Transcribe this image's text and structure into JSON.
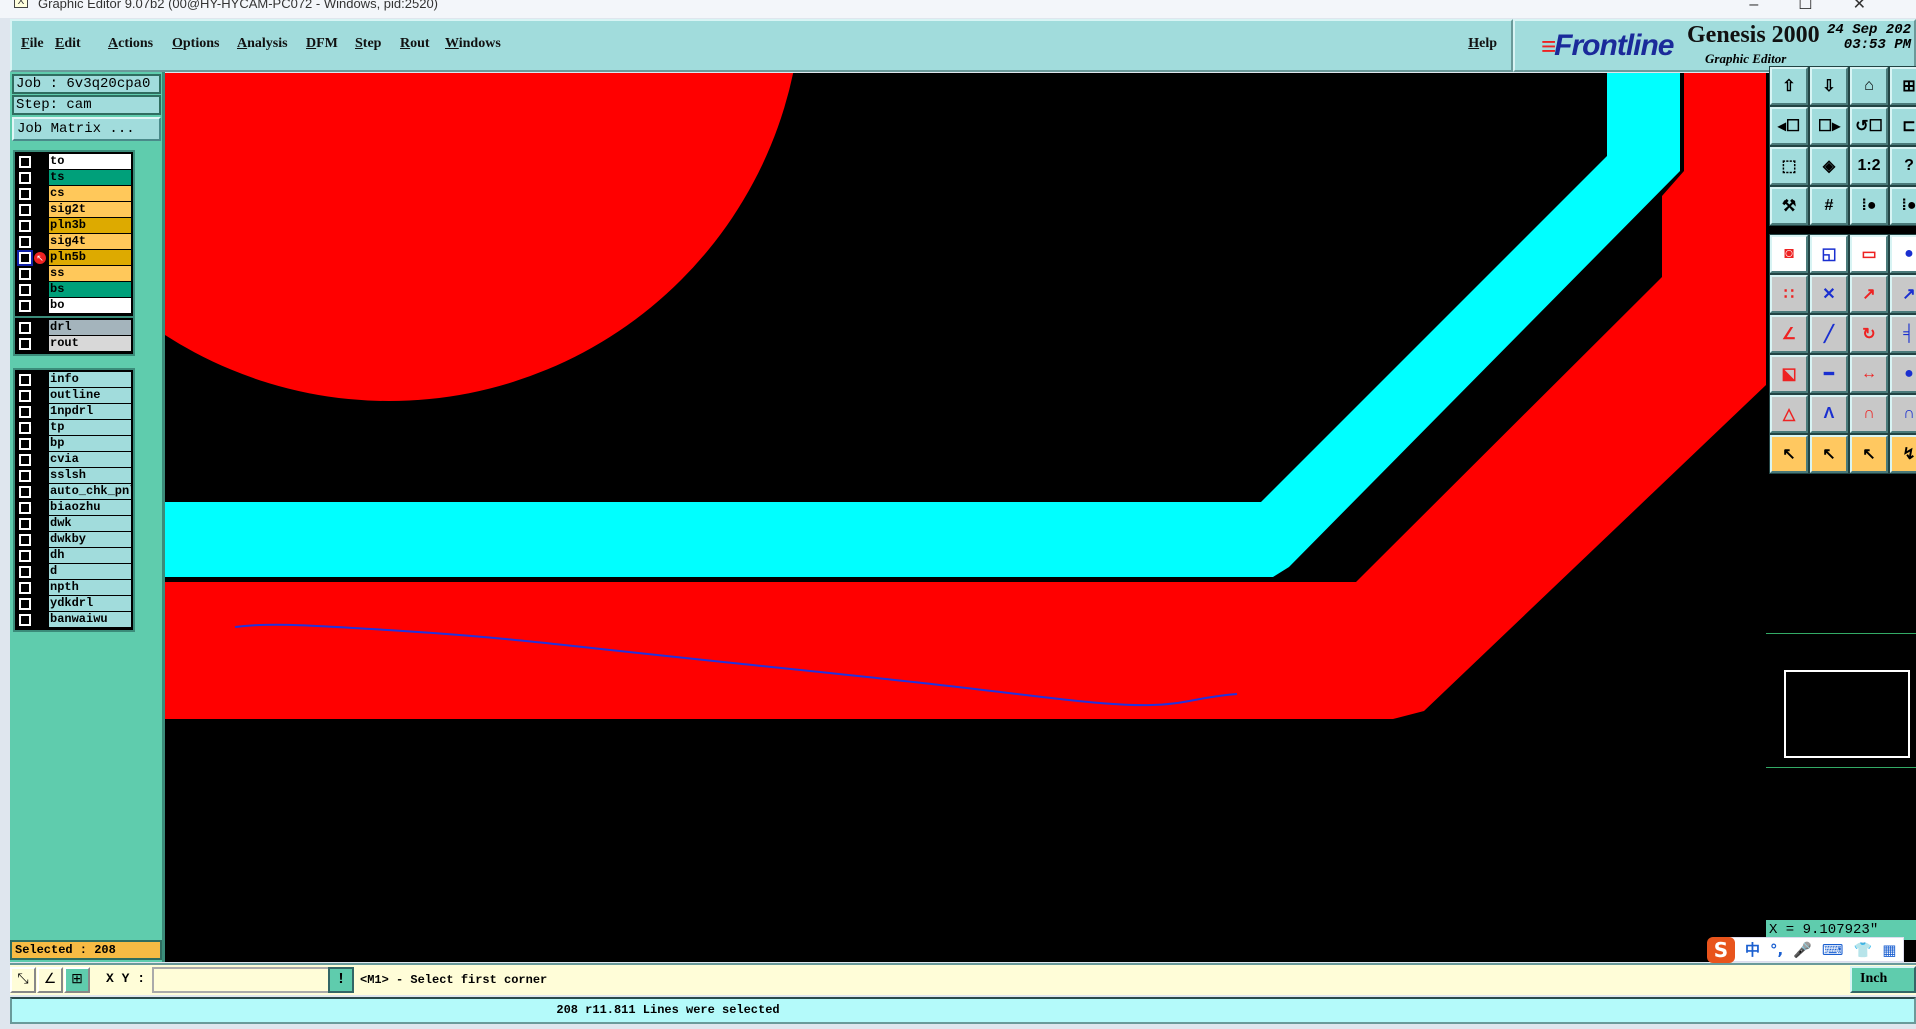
{
  "window": {
    "title": "Graphic Editor 9.07b2 (00@HY-HYCAM-PC072 - Windows, pid:2520)",
    "controls": [
      "–",
      "☐",
      "✕"
    ]
  },
  "menu": {
    "items": [
      "File",
      "Edit",
      "Actions",
      "Options",
      "Analysis",
      "DFM",
      "Step",
      "Rout",
      "Windows"
    ],
    "help": "Help"
  },
  "brand": {
    "logo": "Frontline",
    "product": "Genesis 2000",
    "subtitle": "Graphic Editor",
    "date": "24 Sep 202",
    "time": "03:53 PM"
  },
  "job": {
    "job_label": "Job : 6v3q20cpa0",
    "step_label": "Step: cam",
    "job_matrix_button": "Job Matrix ..."
  },
  "layers": {
    "board": [
      {
        "name": "to",
        "color": "#ffffff"
      },
      {
        "name": "ts",
        "color": "#00a07a"
      },
      {
        "name": "cs",
        "color": "#ffc85a"
      },
      {
        "name": "sig2t",
        "color": "#ffc85a"
      },
      {
        "name": "pln3b",
        "color": "#ddaa00"
      },
      {
        "name": "sig4t",
        "color": "#ffc85a"
      },
      {
        "name": "pln5b",
        "color": "#ddaa00",
        "active": true
      },
      {
        "name": "ss",
        "color": "#ffc85a"
      },
      {
        "name": "bs",
        "color": "#00a07a"
      },
      {
        "name": "bo",
        "color": "#ffffff"
      }
    ],
    "drill": [
      {
        "name": "drl",
        "color": "#a4b4bc"
      },
      {
        "name": "rout",
        "color": "#d8d8d8"
      }
    ],
    "misc": [
      {
        "name": "info"
      },
      {
        "name": "outline"
      },
      {
        "name": "1npdrl"
      },
      {
        "name": "tp"
      },
      {
        "name": "bp"
      },
      {
        "name": "cvia"
      },
      {
        "name": "sslsh"
      },
      {
        "name": "auto_chk_pnl"
      },
      {
        "name": "biaozhu"
      },
      {
        "name": "dwk"
      },
      {
        "name": "dwkby"
      },
      {
        "name": "dh"
      },
      {
        "name": "d"
      },
      {
        "name": "npth"
      },
      {
        "name": "ydkdrl"
      },
      {
        "name": "banwaiwu"
      }
    ],
    "misc_color": "#a1dcdc"
  },
  "selected": "Selected : 208",
  "canvas": {
    "colors": {
      "background": "#000000",
      "red_layer": "#ff0000",
      "cyan_layer": "#00ffff",
      "selection_line": "#2233dd"
    }
  },
  "toolbar": {
    "icons": [
      [
        "page-up-icon",
        "page-down-icon",
        "home-icon",
        "grid-xy-icon"
      ],
      [
        "pan-left-icon",
        "pan-right-icon",
        "undo-view-icon",
        "snap-icon"
      ],
      [
        "zoom-fit-icon",
        "zoom-center-icon",
        "zoom-ratio-icon",
        "help-icon"
      ],
      [
        "tools-icon",
        "grid-icon",
        "layers-compare-icon",
        "layers-compare-2-icon"
      ],
      [
        "feature-select-icon",
        "area-select-icon",
        "ruler-icon",
        "pad-icon"
      ],
      [
        "connect-icon",
        "delete-node-icon",
        "move-point-icon",
        "move-point-2-icon"
      ],
      [
        "angle-line-icon",
        "line-slope-icon",
        "arc-icon",
        "mirror-icon"
      ],
      [
        "copy-pad-icon",
        "line-split-icon",
        "dimension-icon",
        "pads-icon"
      ],
      [
        "triangle-edit-icon",
        "arrow-edit-icon",
        "arc-edit-icon",
        "arc-edit-2-icon"
      ],
      [
        "pointer-icon",
        "pointer-box-icon",
        "pointer-octagon-icon",
        "route-icon"
      ]
    ],
    "ratio_label": "1:2"
  },
  "readout": {
    "x": "X = 9.107923\""
  },
  "bottom": {
    "xy_label": "X Y :",
    "xy_value": "",
    "prompt": "<M1> - Select first corner",
    "units": "Inch"
  },
  "status": "208 r11.811 Lines were selected",
  "ime": {
    "items": [
      "S",
      "中",
      "°,",
      "🎤",
      "⌨",
      "👕",
      "▦"
    ]
  }
}
